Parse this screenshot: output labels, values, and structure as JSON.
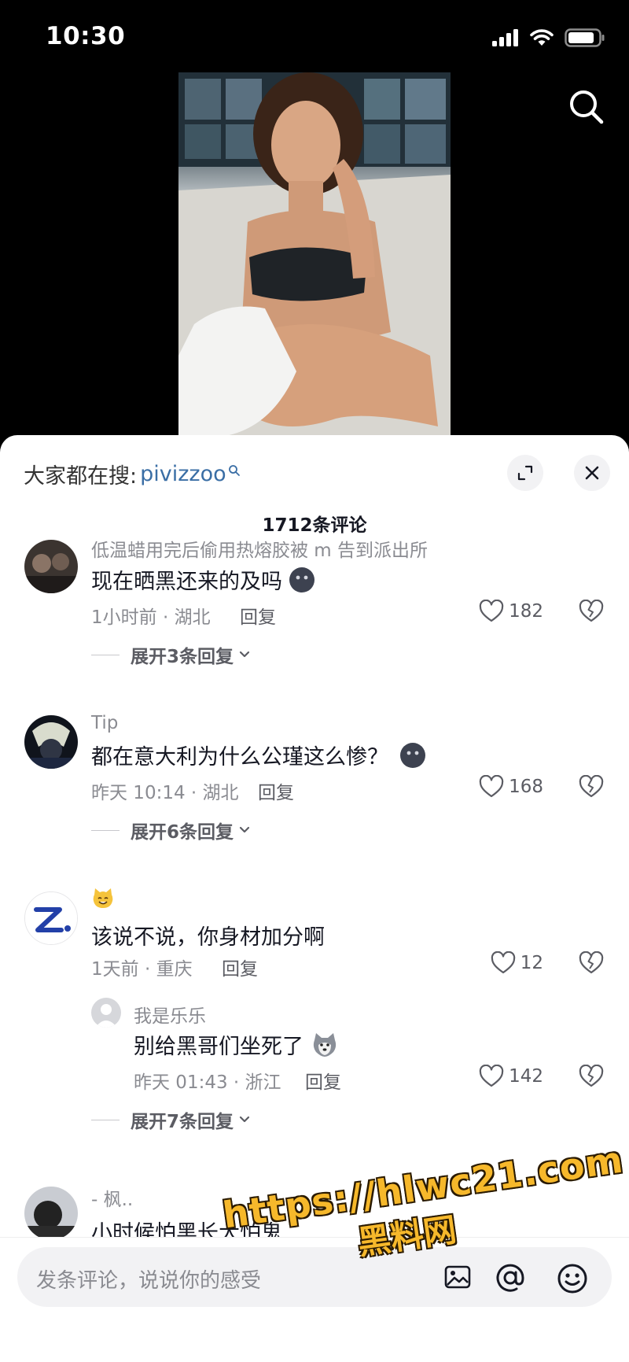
{
  "status_bar": {
    "time": "10:30"
  },
  "hot_search": {
    "prefix": "大家都在搜:",
    "term": "pivizzoo"
  },
  "comment_count": "1712条评论",
  "comments": [
    {
      "username": "低温蜡用完后偷用热熔胶被 m 告到派出所",
      "text": "现在晒黑还来的及吗",
      "time_location": "1小时前 · 湖北",
      "reply_label": "回复",
      "likes": "182",
      "expand_label": "展开3条回复"
    },
    {
      "username": "Tip",
      "text": "都在意大利为什么公瑾这么惨？",
      "time_location": "昨天 10:14 · 湖北",
      "reply_label": "回复",
      "likes": "168",
      "expand_label": "展开6条回复"
    },
    {
      "username": "😸",
      "text": "该说不说，你身材加分啊",
      "time_location": "1天前 · 重庆",
      "reply_label": "回复",
      "likes": "12",
      "reply": {
        "username": "我是乐乐",
        "text": "别给黑哥们坐死了",
        "time_location": "昨天 01:43 · 浙江",
        "reply_label": "回复",
        "likes": "142"
      },
      "expand_label": "展开7条回复"
    },
    {
      "username": "- 枫..",
      "text": "小时候怕黑长大怕鬼"
    }
  ],
  "input": {
    "placeholder": "发条评论，说说你的感受"
  },
  "watermark": {
    "url": "https://hlwc21.com",
    "cn": "黑料网"
  },
  "icons": {
    "search": "search-icon",
    "expand": "expand-icon",
    "close": "close-icon",
    "like": "heart-icon",
    "dislike": "broken-heart-icon",
    "image": "image-icon",
    "mention": "at-icon",
    "emoji": "smiley-icon"
  },
  "colors": {
    "accent_link": "#3a6ea5",
    "watermark": "#f6b82b"
  }
}
